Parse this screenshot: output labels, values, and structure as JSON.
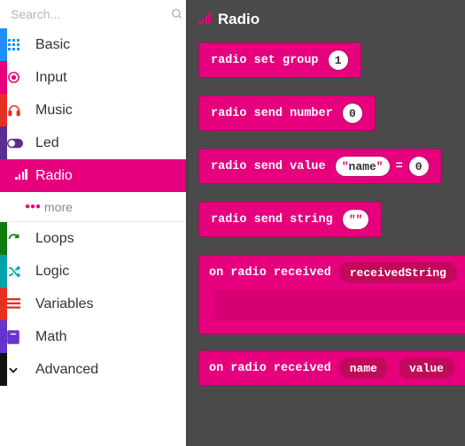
{
  "search": {
    "placeholder": "Search..."
  },
  "categories": [
    {
      "id": "basic",
      "label": "Basic",
      "color": "#1E90FF",
      "iconColor": "#1E90FF"
    },
    {
      "id": "input",
      "label": "Input",
      "color": "#E6007E",
      "iconColor": "#E6007E"
    },
    {
      "id": "music",
      "label": "Music",
      "color": "#E63022",
      "iconColor": "#E63022"
    },
    {
      "id": "led",
      "label": "Led",
      "color": "#5C2D91",
      "iconColor": "#5C2D91"
    },
    {
      "id": "radio",
      "label": "Radio",
      "color": "#E6007E",
      "iconColor": "#FFFFFF",
      "active": true
    },
    {
      "id": "radio-more",
      "label": "more",
      "sub": true
    },
    {
      "id": "loops",
      "label": "Loops",
      "color": "#107C10",
      "iconColor": "#107C10"
    },
    {
      "id": "logic",
      "label": "Logic",
      "color": "#00A4A6",
      "iconColor": "#00A4A6"
    },
    {
      "id": "variables",
      "label": "Variables",
      "color": "#E63022",
      "iconColor": "#E63022"
    },
    {
      "id": "math",
      "label": "Math",
      "color": "#6633CC",
      "iconColor": "#6633CC"
    },
    {
      "id": "advanced",
      "label": "Advanced",
      "color": "#111111",
      "iconColor": "#111111"
    }
  ],
  "flyout": {
    "title": "Radio",
    "blocks": {
      "set_group": {
        "text": "radio set group",
        "value": "1"
      },
      "send_number": {
        "text": "radio send number",
        "value": "0"
      },
      "send_value": {
        "text": "radio send value",
        "name": "name",
        "eq": "=",
        "value": "0"
      },
      "send_string": {
        "text": "radio send string",
        "value": ""
      },
      "on_recv_string": {
        "text": "on radio received",
        "param": "receivedString"
      },
      "on_recv_nv": {
        "text": "on radio received",
        "p1": "name",
        "p2": "value"
      }
    }
  }
}
